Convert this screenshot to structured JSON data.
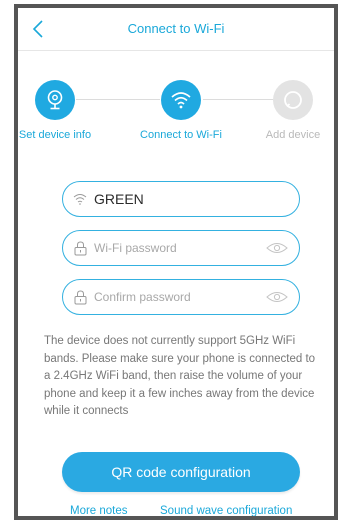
{
  "header": {
    "title": "Connect to Wi-Fi",
    "back_icon": "chevron-left-icon"
  },
  "steps": [
    {
      "label": "Set device info",
      "icon": "camera-icon",
      "state": "active"
    },
    {
      "label": "Connect to Wi-Fi",
      "icon": "wifi-icon",
      "state": "active"
    },
    {
      "label": "Add device",
      "icon": "search-icon",
      "state": "inactive"
    }
  ],
  "form": {
    "ssid": {
      "value": "GREEN",
      "icon": "wifi-icon"
    },
    "password": {
      "placeholder": "Wi-Fi password",
      "icon": "lock-icon",
      "toggle_icon": "eye-icon"
    },
    "confirm": {
      "placeholder": "Confirm password",
      "icon": "lock-icon",
      "toggle_icon": "eye-icon"
    }
  },
  "notice": "The device does not currently support 5GHz WiFi bands. Please make sure your phone is connected to a 2.4GHz WiFi band, then raise the volume of your phone and keep it a few inches away from the device while it connects",
  "actions": {
    "qr_button": "QR code configuration",
    "more_notes": "More notes",
    "sound_wave": "Sound wave configuration"
  },
  "colors": {
    "accent": "#20a9e1",
    "inactive": "#e3e3e3",
    "text_muted": "#777777"
  }
}
